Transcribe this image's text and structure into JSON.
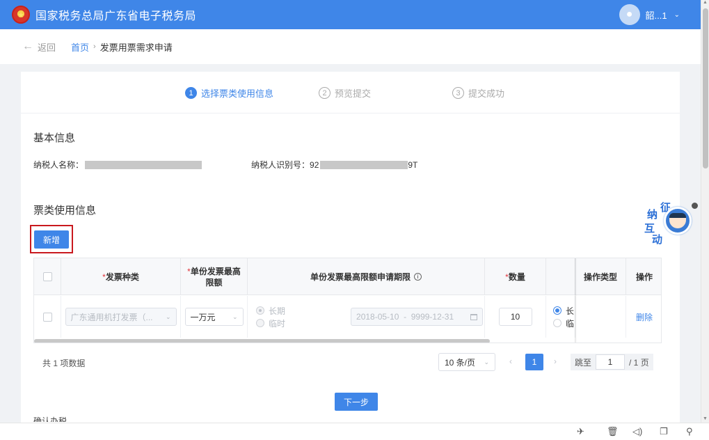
{
  "header": {
    "title": "国家税务总局广东省电子税务局",
    "user_name": "韶...1",
    "emblem_icon": "tax-emblem-icon",
    "brand_color": "#3f86e8"
  },
  "breadcrumb": {
    "back_label": "返回",
    "home": "首页",
    "current": "发票用票需求申请"
  },
  "steps": [
    {
      "num": "1",
      "label": "选择票类使用信息",
      "active": true
    },
    {
      "num": "2",
      "label": "预览提交",
      "active": false
    },
    {
      "num": "3",
      "label": "提交成功",
      "active": false
    }
  ],
  "basic_info": {
    "title": "基本信息",
    "taxpayer_name_label": "纳税人名称：",
    "taxpayer_name_value_tail": "",
    "taxpayer_id_label": "纳税人识别号：",
    "taxpayer_id_prefix": "92",
    "taxpayer_id_suffix": "9T"
  },
  "usage_info": {
    "title": "票类使用信息",
    "add_button": "新增"
  },
  "table": {
    "columns": {
      "invoice_type": "发票种类",
      "max_amount_line1": "单份发票最高",
      "max_amount_line2": "限额",
      "max_period": "单份发票最高限额申请期限",
      "quantity": "数量",
      "op_type": "操作类型",
      "operation": "操作"
    },
    "required_mark": "*",
    "rows": [
      {
        "invoice_type": "广东通用机打发票（...",
        "max_amount": "一万元",
        "period_long": "长期",
        "period_temp": "临时",
        "date_range": "2018-05-10  -  9999-12-31",
        "quantity": "10",
        "qty_period_long": "长",
        "qty_period_temp": "临",
        "op_type": "",
        "action": "删除"
      }
    ]
  },
  "pagination": {
    "total_text": "共 1 项数据",
    "page_size": "10 条/页",
    "current_page": "1",
    "jump_label": "跳至",
    "jump_value": "1",
    "total_pages": "/ 1 页"
  },
  "footer_actions": {
    "next_button": "下一步",
    "cut_text": "确认办税"
  },
  "widget": {
    "chars": [
      "征",
      "纳",
      "互",
      "动"
    ]
  },
  "bottom_tools": [
    "rocket-icon",
    "trash-icon",
    "speaker-icon",
    "window-icon",
    "search-icon"
  ]
}
